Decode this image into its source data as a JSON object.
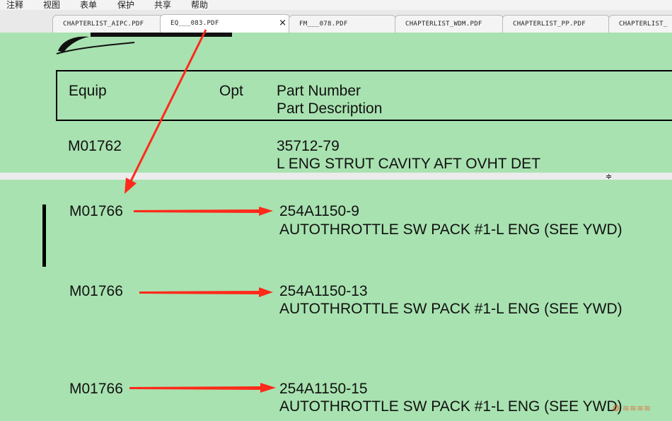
{
  "menu": [
    "注释",
    "视图",
    "表单",
    "保护",
    "共享",
    "帮助"
  ],
  "tabs": [
    {
      "label": "CHAPTERLIST_AIPC.PDF"
    },
    {
      "label": "EQ___083.PDF",
      "close": "×"
    },
    {
      "label": "FM___078.PDF"
    },
    {
      "label": "CHAPTERLIST_WDM.PDF"
    },
    {
      "label": "CHAPTERLIST_PP.PDF"
    },
    {
      "label": "CHAPTERLIST_"
    }
  ],
  "header": {
    "equip": "Equip",
    "opt": "Opt",
    "part_number": "Part Number",
    "part_description": "Part Description"
  },
  "rows": [
    {
      "equip": "M01762",
      "part_number": "35712-79",
      "description": "L ENG STRUT CAVITY AFT OVHT DET"
    },
    {
      "equip": "M01766",
      "part_number": "254A1150-9",
      "description": "AUTOTHROTTLE SW PACK #1-L ENG (SEE YWD)"
    },
    {
      "equip": "M01766",
      "part_number": "254A1150-13",
      "description": "AUTOTHROTTLE SW PACK #1-L ENG (SEE YWD)"
    },
    {
      "equip": "M01766",
      "part_number": "254A1150-15",
      "description": "AUTOTHROTTLE SW PACK #1-L ENG (SEE YWD)"
    }
  ],
  "separator_mark": "≑",
  "colors": {
    "page": "#a8e2b0",
    "arrow": "#ff2a1a"
  },
  "icons": {
    "logo": "boeing-logo-icon",
    "tab_close": "close-icon"
  }
}
